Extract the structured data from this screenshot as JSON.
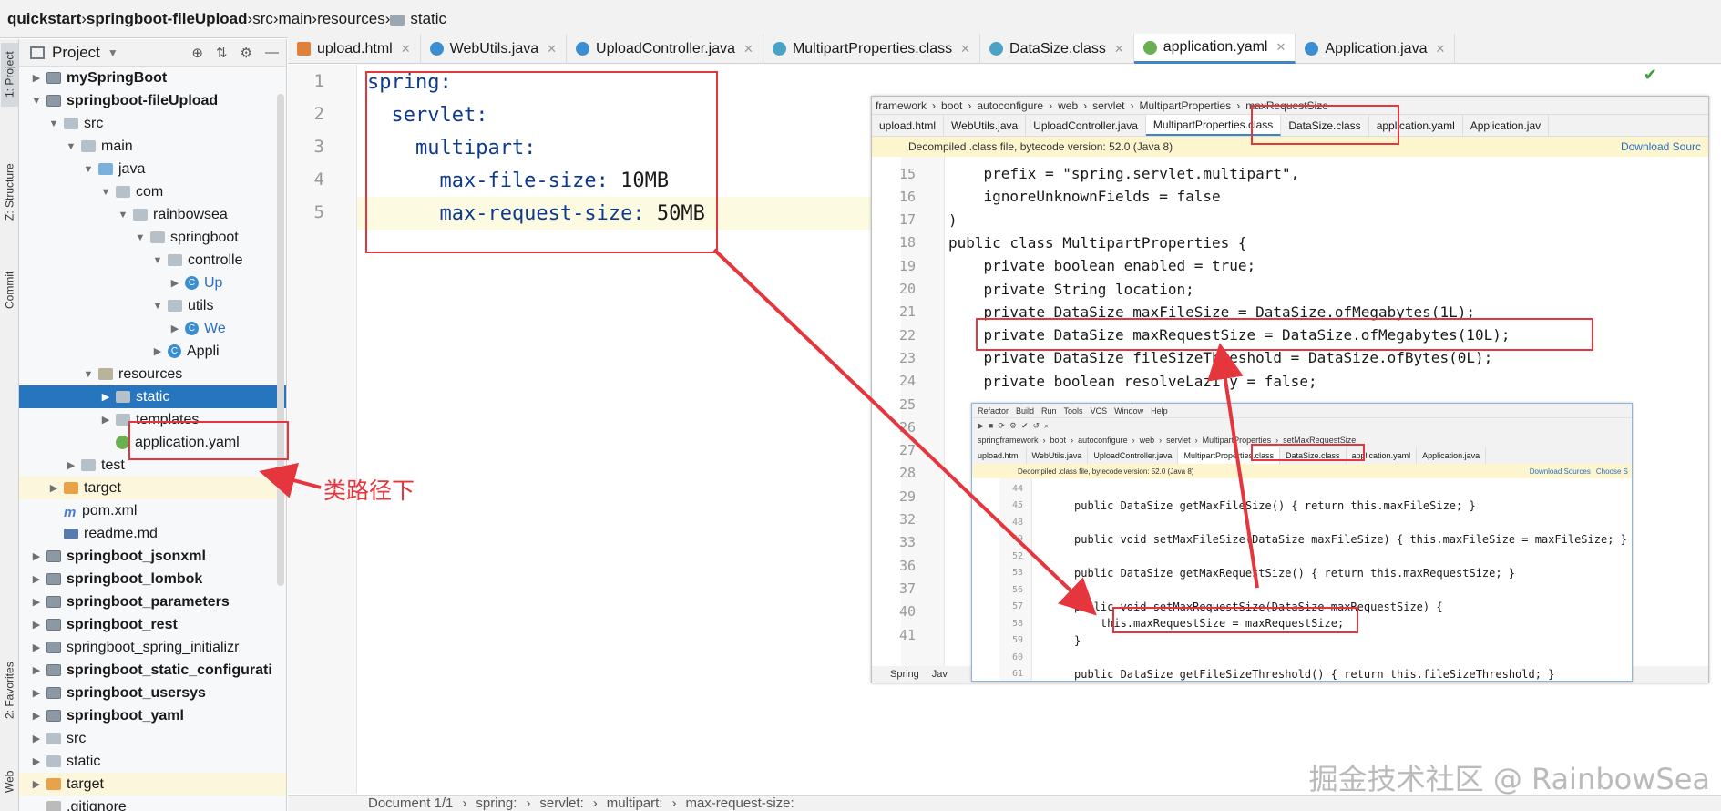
{
  "breadcrumb": {
    "items": [
      "quickstart",
      "springboot-fileUpload",
      "src",
      "main",
      "resources",
      "static"
    ]
  },
  "left_strip": {
    "tabs": [
      "1: Project",
      "Z: Structure",
      "Commit",
      "2: Favorites",
      "Web"
    ]
  },
  "project_panel": {
    "title": "Project",
    "tree": [
      {
        "label": "mySpringBoot",
        "depth": 1,
        "icon": "module-folder-icon",
        "arrow": "right",
        "bold": true
      },
      {
        "label": "springboot-fileUpload",
        "depth": 1,
        "icon": "module-folder-icon",
        "arrow": "down",
        "bold": true
      },
      {
        "label": "src",
        "depth": 2,
        "icon": "folder-icon",
        "arrow": "down"
      },
      {
        "label": "main",
        "depth": 3,
        "icon": "folder-icon",
        "arrow": "down"
      },
      {
        "label": "java",
        "depth": 4,
        "icon": "source-folder-icon",
        "arrow": "down"
      },
      {
        "label": "com",
        "depth": 5,
        "icon": "package-icon",
        "arrow": "down"
      },
      {
        "label": "rainbowsea",
        "depth": 6,
        "icon": "package-icon",
        "arrow": "down"
      },
      {
        "label": "springboot",
        "depth": 7,
        "icon": "package-icon",
        "arrow": "down"
      },
      {
        "label": "controlle",
        "depth": 8,
        "icon": "package-icon",
        "arrow": "down"
      },
      {
        "label": "Up",
        "depth": 9,
        "icon": "class-icon",
        "arrow": "right",
        "blue": true
      },
      {
        "label": "utils",
        "depth": 8,
        "icon": "package-icon",
        "arrow": "down"
      },
      {
        "label": "We",
        "depth": 9,
        "icon": "class-icon",
        "arrow": "right",
        "blue": true
      },
      {
        "label": "Appli",
        "depth": 8,
        "icon": "class-icon",
        "arrow": "right"
      },
      {
        "label": "resources",
        "depth": 4,
        "icon": "resources-folder-icon",
        "arrow": "down"
      },
      {
        "label": "static",
        "depth": 5,
        "icon": "folder-icon",
        "arrow": "right",
        "selected": true
      },
      {
        "label": "templates",
        "depth": 5,
        "icon": "folder-icon",
        "arrow": "right"
      },
      {
        "label": "application.yaml",
        "depth": 5,
        "icon": "yaml-file-icon",
        "arrow": ""
      },
      {
        "label": "test",
        "depth": 3,
        "icon": "folder-icon",
        "arrow": "right"
      },
      {
        "label": "target",
        "depth": 2,
        "icon": "target-folder-icon",
        "arrow": "right",
        "highlight": true
      },
      {
        "label": "pom.xml",
        "depth": 2,
        "icon": "maven-icon",
        "arrow": ""
      },
      {
        "label": "readme.md",
        "depth": 2,
        "icon": "markdown-icon",
        "arrow": ""
      },
      {
        "label": "springboot_jsonxml",
        "depth": 1,
        "icon": "module-folder-icon",
        "arrow": "right",
        "bold": true
      },
      {
        "label": "springboot_lombok",
        "depth": 1,
        "icon": "module-folder-icon",
        "arrow": "right",
        "bold": true
      },
      {
        "label": "springboot_parameters",
        "depth": 1,
        "icon": "module-folder-icon",
        "arrow": "right",
        "bold": true
      },
      {
        "label": "springboot_rest",
        "depth": 1,
        "icon": "module-folder-icon",
        "arrow": "right",
        "bold": true
      },
      {
        "label": "springboot_spring_initializr",
        "depth": 1,
        "icon": "module-folder-icon",
        "arrow": "right"
      },
      {
        "label": "springboot_static_configurati",
        "depth": 1,
        "icon": "module-folder-icon",
        "arrow": "right",
        "bold": true
      },
      {
        "label": "springboot_usersys",
        "depth": 1,
        "icon": "module-folder-icon",
        "arrow": "right",
        "bold": true
      },
      {
        "label": "springboot_yaml",
        "depth": 1,
        "icon": "module-folder-icon",
        "arrow": "right",
        "bold": true
      },
      {
        "label": "src",
        "depth": 1,
        "icon": "folder-icon",
        "arrow": "right"
      },
      {
        "label": "static",
        "depth": 1,
        "icon": "folder-icon",
        "arrow": "right"
      },
      {
        "label": "target",
        "depth": 1,
        "icon": "target-folder-icon",
        "arrow": "right",
        "highlight": true
      },
      {
        "label": ".gitignore",
        "depth": 1,
        "icon": "file-icon",
        "arrow": ""
      }
    ]
  },
  "editor": {
    "tabs": [
      {
        "label": "upload.html",
        "icon": "html"
      },
      {
        "label": "WebUtils.java",
        "icon": "java"
      },
      {
        "label": "UploadController.java",
        "icon": "java"
      },
      {
        "label": "MultipartProperties.class",
        "icon": "clsf"
      },
      {
        "label": "DataSize.class",
        "icon": "clsf"
      },
      {
        "label": "application.yaml",
        "icon": "yml",
        "active": true
      },
      {
        "label": "Application.java",
        "icon": "java"
      }
    ],
    "lines": [
      {
        "n": "1",
        "key": "spring:",
        "val": ""
      },
      {
        "n": "2",
        "key": "  servlet:",
        "val": ""
      },
      {
        "n": "3",
        "key": "    multipart:",
        "val": ""
      },
      {
        "n": "4",
        "key": "      max-file-size:",
        "val": " 10MB"
      },
      {
        "n": "5",
        "key": "      max-request-size:",
        "val": " 50MB"
      }
    ]
  },
  "status_bar": {
    "items": [
      "Document 1/1",
      "spring:",
      "servlet:",
      "multipart:",
      "max-request-size:"
    ]
  },
  "annotation_text": "类路径下",
  "watermark": "掘金技术社区 @ RainbowSea",
  "screenshot1": {
    "breadcrumb": [
      "framework",
      "boot",
      "autoconfigure",
      "web",
      "servlet",
      "MultipartProperties",
      "maxRequestSize"
    ],
    "tabs": [
      "upload.html",
      "WebUtils.java",
      "UploadController.java",
      "MultipartProperties.class",
      "DataSize.class",
      "application.yaml",
      "Application.jav"
    ],
    "warning": "Decompiled .class file, bytecode version: 52.0 (Java 8)",
    "download": "Download Sourc",
    "lines": [
      {
        "n": "15",
        "text": "    prefix = \"spring.servlet.multipart\","
      },
      {
        "n": "16",
        "text": "    ignoreUnknownFields = false"
      },
      {
        "n": "17",
        "text": ")"
      },
      {
        "n": "18",
        "text": "public class MultipartProperties {"
      },
      {
        "n": "19",
        "text": "    private boolean enabled = true;"
      },
      {
        "n": "20",
        "text": "    private String location;"
      },
      {
        "n": "21",
        "text": "    private DataSize maxFileSize = DataSize.ofMegabytes(1L);"
      },
      {
        "n": "22",
        "text": "    private DataSize maxRequestSize = DataSize.ofMegabytes(10L);"
      },
      {
        "n": "23",
        "text": "    private DataSize fileSizeThreshold = DataSize.ofBytes(0L);"
      },
      {
        "n": "24",
        "text": "    private boolean resolveLazily = false;"
      },
      {
        "n": "25",
        "text": ""
      },
      {
        "n": "26",
        "text": ""
      },
      {
        "n": "27",
        "text": ""
      },
      {
        "n": "28",
        "text": ""
      },
      {
        "n": "29",
        "text": ""
      },
      {
        "n": "32",
        "text": ""
      },
      {
        "n": "33",
        "text": ""
      },
      {
        "n": "36",
        "text": ""
      },
      {
        "n": "37",
        "text": ""
      },
      {
        "n": "40",
        "text": ""
      },
      {
        "n": "41",
        "text": ""
      }
    ],
    "bottom_tabs": [
      "Spring",
      "Jav"
    ]
  },
  "screenshot2": {
    "breadcrumb": [
      "springframework",
      "boot",
      "autoconfigure",
      "web",
      "servlet",
      "MultipartProperties",
      "setMaxRequestSize"
    ],
    "tabs": [
      "upload.html",
      "WebUtils.java",
      "UploadController.java",
      "MultipartProperties.class",
      "DataSize.class",
      "application.yaml",
      "Application.java"
    ],
    "warning": "Decompiled .class file, bytecode version: 52.0 (Java 8)",
    "download": "Download Sources",
    "choose": "Choose S",
    "lines": [
      {
        "n": "44",
        "text": ""
      },
      {
        "n": "45",
        "text": "public DataSize getMaxFileSize() { return this.maxFileSize; }"
      },
      {
        "n": "48",
        "text": ""
      },
      {
        "n": "49",
        "text": "public void setMaxFileSize(DataSize maxFileSize) { this.maxFileSize = maxFileSize; }"
      },
      {
        "n": "52",
        "text": ""
      },
      {
        "n": "53",
        "text": "public DataSize getMaxRequestSize() { return this.maxRequestSize; }"
      },
      {
        "n": "56",
        "text": ""
      },
      {
        "n": "57",
        "text": "public void setMaxRequestSize(DataSize maxRequestSize) {"
      },
      {
        "n": "58",
        "text": "    this.maxRequestSize = maxRequestSize;"
      },
      {
        "n": "59",
        "text": "}"
      },
      {
        "n": "60",
        "text": ""
      },
      {
        "n": "61",
        "text": "public DataSize getFileSizeThreshold() { return this.fileSizeThreshold; }"
      }
    ]
  },
  "colors": {
    "accent_red": "#e5353d",
    "selection_blue": "#2675bf",
    "yaml_key": "#0d3a8f"
  }
}
